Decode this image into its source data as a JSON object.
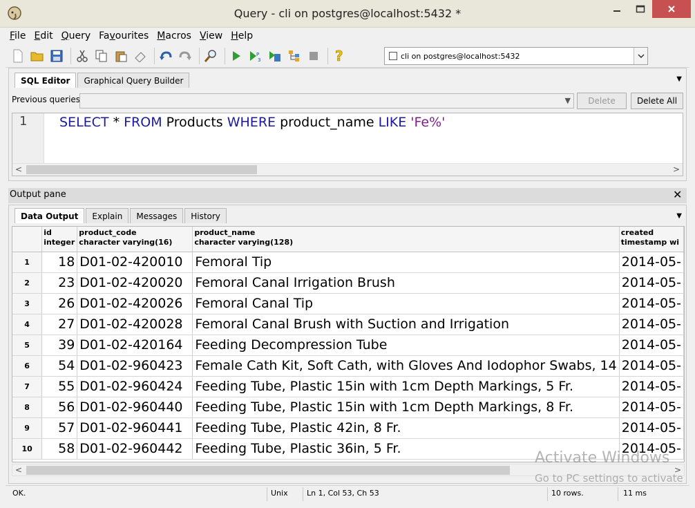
{
  "window": {
    "title": "Query - cli on postgres@localhost:5432 *"
  },
  "menu": [
    {
      "label": "File",
      "u": "F",
      "rest": "ile"
    },
    {
      "label": "Edit",
      "u": "E",
      "rest": "dit"
    },
    {
      "label": "Query",
      "u": "Q",
      "rest": "uery"
    },
    {
      "label": "Favourites",
      "u": "",
      "pre": "Fa",
      "uc": "v",
      "rest": "ourites"
    },
    {
      "label": "Macros",
      "u": "M",
      "rest": "acros"
    },
    {
      "label": "View",
      "u": "V",
      "rest": "iew"
    },
    {
      "label": "Help",
      "u": "H",
      "rest": "elp"
    }
  ],
  "toolbar": {
    "connection": "cli on postgres@localhost:5432"
  },
  "editor": {
    "tabs": [
      "SQL Editor",
      "Graphical Query Builder"
    ],
    "previous_queries_label": "Previous queries",
    "delete_label": "Delete",
    "delete_all_label": "Delete All",
    "line_number": "1",
    "query": {
      "kw1": "SELECT",
      "t1": " * ",
      "kw2": "FROM",
      "t2": " Products ",
      "kw3": "WHERE",
      "t3": " product_name ",
      "kw4": "LIKE",
      "t4": " ",
      "str": "'Fe%'"
    }
  },
  "output": {
    "pane_label": "Output pane",
    "tabs": [
      "Data Output",
      "Explain",
      "Messages",
      "History"
    ],
    "columns": [
      {
        "name": "id",
        "type": "integer"
      },
      {
        "name": "product_code",
        "type": "character varying(16)"
      },
      {
        "name": "product_name",
        "type": "character varying(128)"
      },
      {
        "name": "created",
        "type": "timestamp wi"
      }
    ],
    "rows": [
      {
        "n": "1",
        "id": "18",
        "code": "D01-02-420010",
        "name": "Femoral Tip",
        "created": "2014-05-"
      },
      {
        "n": "2",
        "id": "23",
        "code": "D01-02-420020",
        "name": "Femoral Canal Irrigation Brush",
        "created": "2014-05-"
      },
      {
        "n": "3",
        "id": "26",
        "code": "D01-02-420026",
        "name": "Femoral Canal Tip",
        "created": "2014-05-"
      },
      {
        "n": "4",
        "id": "27",
        "code": "D01-02-420028",
        "name": "Femoral Canal Brush with Suction and Irrigation",
        "created": "2014-05-"
      },
      {
        "n": "5",
        "id": "39",
        "code": "D01-02-420164",
        "name": "Feeding Decompression Tube",
        "created": "2014-05-"
      },
      {
        "n": "6",
        "id": "54",
        "code": "D01-02-960423",
        "name": "Female Cath Kit, Soft Cath, with Gloves And Iodophor Swabs, 14",
        "created": "2014-05-"
      },
      {
        "n": "7",
        "id": "55",
        "code": "D01-02-960424",
        "name": "Feeding Tube, Plastic 15in with 1cm Depth Markings, 5 Fr.",
        "created": "2014-05-"
      },
      {
        "n": "8",
        "id": "56",
        "code": "D01-02-960440",
        "name": "Feeding Tube, Plastic 15in with 1cm Depth Markings, 8 Fr.",
        "created": "2014-05-"
      },
      {
        "n": "9",
        "id": "57",
        "code": "D01-02-960441",
        "name": "Feeding Tube, Plastic 42in, 8 Fr.",
        "created": "2014-05-"
      },
      {
        "n": "10",
        "id": "58",
        "code": "D01-02-960442",
        "name": "Feeding Tube, Plastic 36in, 5 Fr.",
        "created": "2014-05-"
      }
    ]
  },
  "status": {
    "message": "OK.",
    "line_ending": "Unix",
    "position": "Ln 1, Col 53, Ch 53",
    "rows": "10 rows.",
    "time": "11 ms"
  },
  "watermark": {
    "line1": "Activate Windows",
    "line2": "Go to PC settings to activate"
  }
}
